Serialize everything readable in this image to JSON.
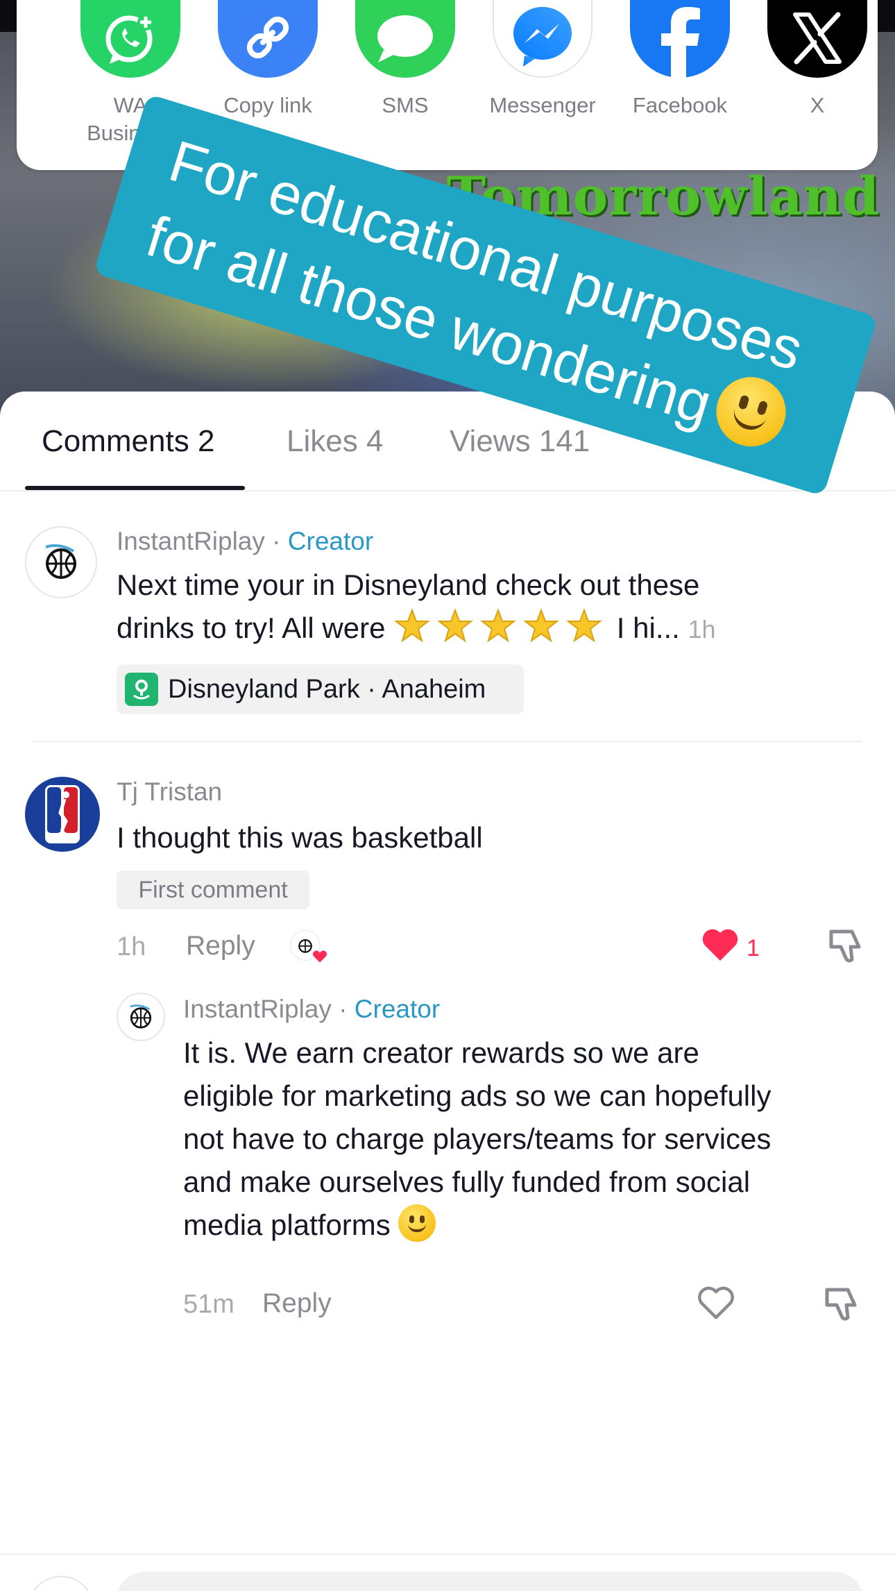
{
  "video": {
    "overlay_text": "Tomorrowland"
  },
  "share": {
    "items": [
      {
        "label": "WA Business",
        "icon": "whatsapp-business-icon",
        "color": "#25d366"
      },
      {
        "label": "Copy link",
        "icon": "link-icon",
        "color": "#3b82f6"
      },
      {
        "label": "SMS",
        "icon": "sms-icon",
        "color": "#2fd158"
      },
      {
        "label": "Messenger",
        "icon": "messenger-icon",
        "color": "#ffffff"
      },
      {
        "label": "Facebook",
        "icon": "facebook-icon",
        "color": "#1877f2"
      },
      {
        "label": "X",
        "icon": "x-icon",
        "color": "#000000"
      }
    ]
  },
  "promo": {
    "line1": "For educational purposes",
    "line2": "for all those wondering",
    "color": "#1ea6c4"
  },
  "tabs": {
    "comments": "Comments 2",
    "likes": "Likes 4",
    "views": "Views 141",
    "search_icon": "search-icon"
  },
  "comments": [
    {
      "author": "InstantRiplay",
      "separator": " · ",
      "role": "Creator",
      "text_part1": "Next time your in Disneyland check out these",
      "text_part2_prefix": "drinks to try! All were ",
      "text_part2_suffix": " I hi...",
      "ago": "1h",
      "location": "Disneyland Park · Anaheim"
    },
    {
      "author": "Tj Tristan",
      "text": "I thought this was basketball",
      "badge": "First comment",
      "ago": "1h",
      "reply_label": "Reply",
      "likes": "1"
    }
  ],
  "reply": {
    "author": "InstantRiplay",
    "separator": " · ",
    "role": "Creator",
    "lines": [
      "It is. We earn creator rewards so we are",
      "eligible for marketing ads so we can hopefully",
      "not have to charge players/teams for services",
      "and make ourselves fully funded from social",
      "media platforms "
    ],
    "ago": "51m",
    "reply_label": "Reply"
  },
  "colors": {
    "accent_creator": "#2a98c4",
    "like_red": "#fe2c55",
    "text_primary": "#161823",
    "text_secondary": "#8a8b91"
  }
}
